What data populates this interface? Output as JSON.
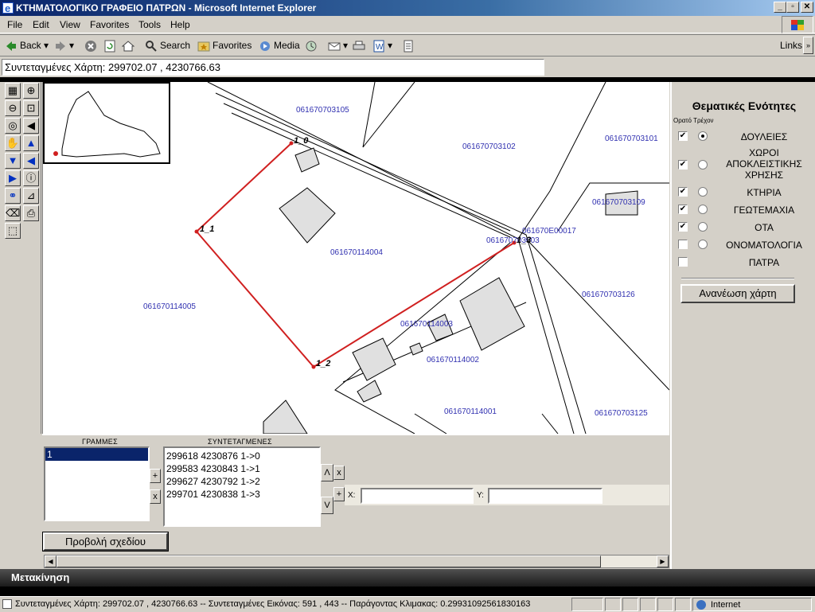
{
  "window": {
    "title": "ΚΤΗΜΑΤΟΛΟΓΙΚΟ ΓΡΑΦΕΙΟ ΠΑΤΡΩΝ - Microsoft Internet Explorer",
    "min": "_",
    "max": "▫",
    "close": "✕"
  },
  "menu": [
    "File",
    "Edit",
    "View",
    "Favorites",
    "Tools",
    "Help"
  ],
  "toolbar": {
    "back": "Back",
    "search": "Search",
    "favorites": "Favorites",
    "media": "Media",
    "links": "Links"
  },
  "coords_field": "Συντεταγμένες Χάρτη: 299702.07 , 4230766.63",
  "map": {
    "labels": [
      "061670703105",
      "061670703102",
      "061670703101",
      "061670703109",
      "061670114004",
      "061670114005",
      "061670114003",
      "061670114002",
      "061670114001",
      "061670703125",
      "061670703126",
      "061670703003",
      "061670Ε00017"
    ],
    "points": [
      "1_0",
      "1_1",
      "1_2",
      "1_3"
    ]
  },
  "panel": {
    "title": "Θεματικές Ενότητες",
    "sub": "Ορατό Τρέχον",
    "layers": [
      {
        "label": "ΔΟΥΛΕΙΕΣ",
        "visible": true,
        "current": true
      },
      {
        "label": "ΧΩΡΟΙ ΑΠΟΚΛΕΙΣΤΙΚΗΣ ΧΡΗΣΗΣ",
        "visible": true,
        "current": false
      },
      {
        "label": "ΚΤΗΡΙΑ",
        "visible": true,
        "current": false
      },
      {
        "label": "ΓΕΩΤΕΜΑΧΙΑ",
        "visible": true,
        "current": false
      },
      {
        "label": "ΟΤΑ",
        "visible": true,
        "current": false
      },
      {
        "label": "ΟΝΟΜΑΤΟΛΟΓΙΑ",
        "visible": false,
        "current": false
      },
      {
        "label": "ΠΑΤΡΑ",
        "visible": false,
        "current": null
      }
    ],
    "refresh": "Ανανέωση χάρτη"
  },
  "lines": {
    "header": "ΓΡΑΜΜΕΣ",
    "items": [
      "1"
    ],
    "add": "+",
    "remove": "x"
  },
  "coordinates": {
    "header": "ΣΥΝΤΕΤΑΓΜΕΝΕΣ",
    "items": [
      "299618 4230876 1->0",
      "299583 4230843 1->1",
      "299627 4230792 1->2",
      "299701 4230838 1->3"
    ],
    "up": "Λ",
    "down": "V",
    "x_btn": "x",
    "plus": "+",
    "x_label": "X:",
    "y_label": "Y:"
  },
  "view_plan": "Προβολή σχεδίου",
  "mode": "Μετακίνηση",
  "status": {
    "text": "Συντεταγμένες Χάρτη: 299702.07 , 4230766.63 -- Συντεταγμένες Εικόνας: 591 , 443 -- Παράγοντας Κλιμακας: 0.29931092561830163",
    "zone": "Internet"
  }
}
